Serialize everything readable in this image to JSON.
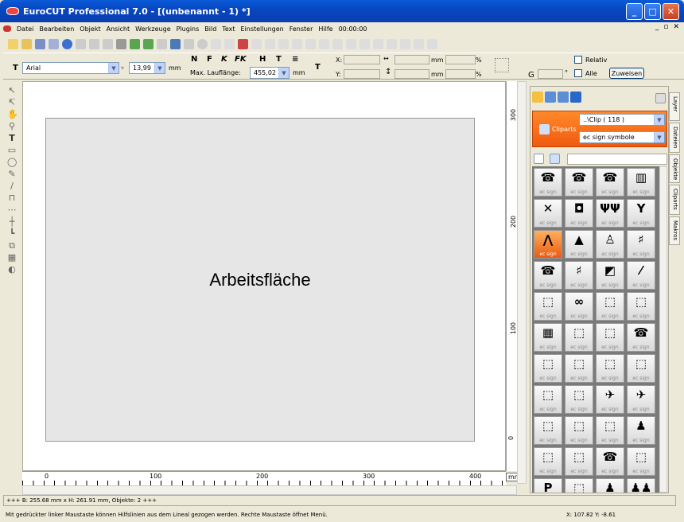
{
  "window": {
    "title": "EuroCUT Professional 7.0 - [(unbenannt - 1) *]",
    "min": "_",
    "max": "□",
    "close": "✕"
  },
  "menu": [
    "Datei",
    "Bearbeiten",
    "Objekt",
    "Ansicht",
    "Werkzeuge",
    "Plugins",
    "Bild",
    "Text",
    "Einstellungen",
    "Fenster",
    "Hilfe",
    "00:00:00"
  ],
  "mdi": {
    "min": "_",
    "restore": "▫",
    "close": "✕"
  },
  "text_toolbar": {
    "font": "Arial",
    "size": "13,99",
    "size_unit": "mm",
    "styles": [
      "N",
      "F",
      "K",
      "FK",
      "H",
      "T"
    ],
    "max_len_label": "Max. Lauflänge:",
    "max_len_value": "455,02",
    "max_len_unit": "mm"
  },
  "transform": {
    "x_label": "X:",
    "y_label": "Y:",
    "w_unit": "mm",
    "h_unit": "mm",
    "pct": "%",
    "relativ": "Relativ",
    "alle": "Alle",
    "assign": "Zuweisen"
  },
  "workarea": {
    "label": "Arbeitsfläche"
  },
  "ruler": {
    "h_ticks": [
      "0",
      "100",
      "200",
      "300",
      "400"
    ],
    "v_ticks": [
      "300",
      "200",
      "100",
      "0"
    ],
    "unit": "mm"
  },
  "status": {
    "line1": "+++ B: 255.68 mm x H: 261.91 mm, Objekte: 2 +++",
    "line2": "Mit gedrückter linker Maustaste können Hilfslinien aus dem Lineal gezogen werden. Rechte Maustaste öffnet Menü.",
    "coords": "X: 107.82 Y: -8.61"
  },
  "panel": {
    "path": "..\\Clip  ( 118 )",
    "cliparts": "Cliparts",
    "category": "ec sign symbole",
    "tabs": [
      "Layer",
      "Dateien",
      "Objekte",
      "Cliparts",
      "Makros"
    ],
    "cell_label": "ec sign",
    "symbols": [
      "☎",
      "☎",
      "☎",
      "▥",
      "✕",
      "◘",
      "ΨΨ",
      "Y",
      "⋀",
      "▲",
      "♙",
      "♯",
      "☎",
      "♯",
      "◩",
      "⁄",
      "⬚",
      "∞",
      "⬚",
      "⬚",
      "▦",
      "⬚",
      "⬚",
      "☎",
      "⬚",
      "⬚",
      "⬚",
      "⬚",
      "⬚",
      "⬚",
      "✈",
      "✈",
      "⬚",
      "⬚",
      "⬚",
      "♟",
      "⬚",
      "⬚",
      "☎",
      "⬚",
      "P",
      "⬚",
      "♟",
      "♟♟"
    ],
    "selected_index": 8
  },
  "colors": {
    "accent": "#f05a10",
    "title": "#0a5bd8"
  }
}
